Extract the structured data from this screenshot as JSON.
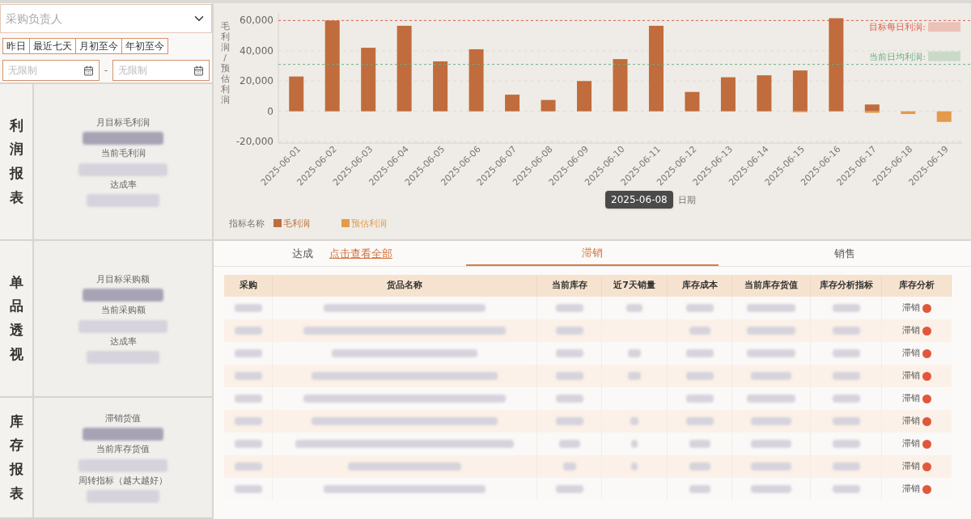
{
  "filters": {
    "owner": {
      "placeholder": "采购负责人"
    },
    "presets": [
      {
        "label": "昨日",
        "selected": false
      },
      {
        "label": "最近七天",
        "selected": false
      },
      {
        "label": "月初至今",
        "selected": false
      },
      {
        "label": "年初至今",
        "selected": false
      }
    ],
    "date_from": {
      "placeholder": "无限制"
    },
    "separator": "-",
    "date_to": {
      "placeholder": "无限制"
    }
  },
  "sections": [
    {
      "title": "利润报表",
      "metrics": [
        {
          "label": "月目标毛利润"
        },
        {
          "label": "当前毛利润"
        },
        {
          "label": "达成率"
        }
      ]
    },
    {
      "title": "单品透视",
      "metrics": [
        {
          "label": "月目标采购额"
        },
        {
          "label": "当前采购额"
        },
        {
          "label": "达成率"
        }
      ]
    },
    {
      "title": "库存报表",
      "metrics": [
        {
          "label": "滞销货值"
        },
        {
          "label": "当前库存货值"
        },
        {
          "label": "周转指标（越大越好）"
        }
      ]
    }
  ],
  "chart": {
    "legend_title": "指标名称",
    "tooltip": "2025-06-08",
    "chart_data": {
      "type": "bar",
      "xlabel": "日期",
      "ylabel": "毛利润/预估利润",
      "stacked": true,
      "categories": [
        "2025-06-01",
        "2025-06-02",
        "2025-06-03",
        "2025-06-04",
        "2025-06-05",
        "2025-06-06",
        "2025-06-07",
        "2025-06-08",
        "2025-06-09",
        "2025-06-10",
        "2025-06-11",
        "2025-06-12",
        "2025-06-13",
        "2025-06-14",
        "2025-06-15",
        "2025-06-16",
        "2025-06-17",
        "2025-06-18",
        "2025-06-19"
      ],
      "series": [
        {
          "name": "毛利润",
          "color": "#c06c3c",
          "values": [
            23000,
            60000,
            42000,
            56500,
            33000,
            41000,
            11000,
            7500,
            20000,
            34500,
            56500,
            12800,
            22500,
            23800,
            27000,
            61500,
            4500,
            null,
            null
          ]
        },
        {
          "name": "预估利润",
          "color": "#e39a4b",
          "values": [
            null,
            null,
            null,
            null,
            null,
            null,
            null,
            null,
            null,
            null,
            null,
            null,
            null,
            null,
            -600,
            null,
            -1000,
            -1800,
            -7000
          ]
        }
      ],
      "ylim": [
        -21000,
        65000
      ],
      "yticks": [
        {
          "value": -20000,
          "label": "-20,000"
        },
        {
          "value": 0,
          "label": "0"
        },
        {
          "value": 20000,
          "label": "20,000"
        },
        {
          "value": 40000,
          "label": "40,000"
        },
        {
          "value": 60000,
          "label": "60,000"
        }
      ],
      "grid": true,
      "legend": "bottom left",
      "ref_lines": [
        {
          "axis": "y",
          "value": 60000,
          "label": "目标每日利润:",
          "color": "#e0604c"
        },
        {
          "axis": "y",
          "value": 31000,
          "label": "当前日均利润:",
          "color": "#6fae84"
        }
      ]
    }
  },
  "tabs": [
    {
      "label": "达成",
      "selected": false,
      "link": "点击查看全部"
    },
    {
      "label": "滞销",
      "selected": true
    },
    {
      "label": "销售",
      "selected": false
    }
  ],
  "table": {
    "columns": [
      "采购",
      "货品名称",
      "当前库存",
      "近7天销量",
      "库存成本",
      "当前库存货值",
      "库存分析指标",
      "库存分析"
    ],
    "rows": [
      {
        "analysis": "滞销"
      },
      {
        "analysis": "滞销"
      },
      {
        "analysis": "滞销"
      },
      {
        "analysis": "滞销"
      },
      {
        "analysis": "滞销"
      },
      {
        "analysis": "滞销"
      },
      {
        "analysis": "滞销"
      },
      {
        "analysis": "滞销"
      },
      {
        "analysis": "滞销"
      }
    ]
  }
}
